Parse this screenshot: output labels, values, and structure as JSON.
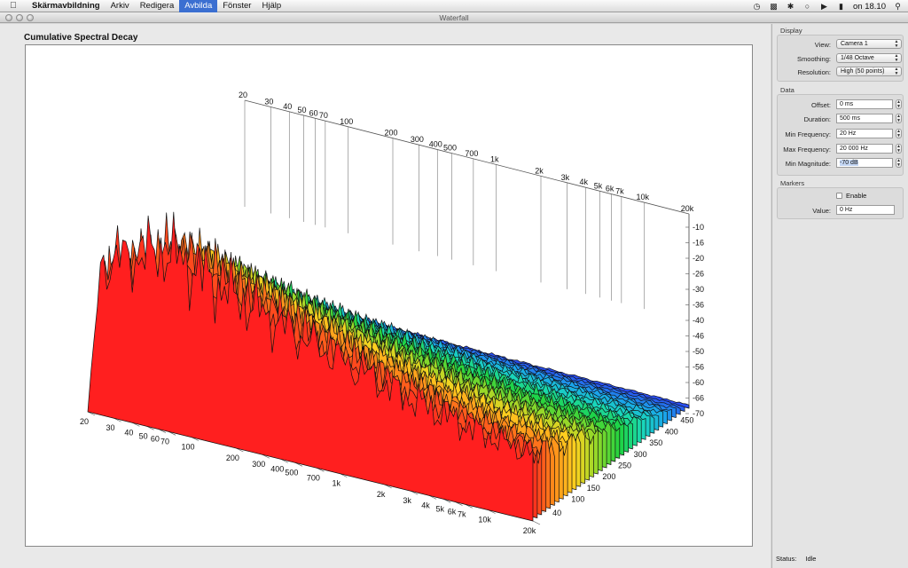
{
  "menubar": {
    "app_name": "Skärmavbildning",
    "items": [
      "Arkiv",
      "Redigera",
      "Avbilda",
      "Fönster",
      "Hjälp"
    ],
    "active_item": "Avbilda",
    "clock": "on 18.10"
  },
  "window": {
    "title": "Waterfall"
  },
  "chart": {
    "title": "Cumulative Spectral Decay"
  },
  "chart_data": {
    "type": "area",
    "title": "Cumulative Spectral Decay",
    "x_axis": {
      "scale": "log",
      "ticks": [
        "20",
        "30",
        "40",
        "50",
        "60",
        "70",
        "100",
        "200",
        "300",
        "400",
        "500",
        "700",
        "1k",
        "2k",
        "3k",
        "4k",
        "5k",
        "6k",
        "7k",
        "10k",
        "20k"
      ]
    },
    "z_axis": {
      "ticks": [
        "40",
        "100",
        "150",
        "200",
        "250",
        "300",
        "350",
        "400",
        "450"
      ]
    },
    "y_axis": {
      "ticks": [
        "-10",
        "-16",
        "-20",
        "-26",
        "-30",
        "-36",
        "-40",
        "-46",
        "-50",
        "-56",
        "-60",
        "-66",
        "-70"
      ]
    },
    "grid": true,
    "colormap": [
      "#ff1f1f",
      "#ff8a1a",
      "#ffd21f",
      "#8ed92a",
      "#1fd33f",
      "#19d9b8",
      "#1aa6ea",
      "#2a4ef0"
    ]
  },
  "inspector": {
    "display": {
      "label": "Display",
      "view_label": "View:",
      "view_value": "Camera 1",
      "smoothing_label": "Smoothing:",
      "smoothing_value": "1/48 Octave",
      "resolution_label": "Resolution:",
      "resolution_value": "High (50 points)"
    },
    "data": {
      "label": "Data",
      "offset_label": "Offset:",
      "offset_value": "0 ms",
      "duration_label": "Duration:",
      "duration_value": "500 ms",
      "min_freq_label": "Min Frequency:",
      "min_freq_value": "20 Hz",
      "max_freq_label": "Max Frequency:",
      "max_freq_value": "20 000 Hz",
      "min_mag_label": "Min Magnitude:",
      "min_mag_value": "-70 dB"
    },
    "markers": {
      "label": "Markers",
      "enable_label": "Enable",
      "value_label": "Value:",
      "value_value": "0 Hz"
    }
  },
  "status": {
    "label": "Status:",
    "value": "Idle"
  }
}
